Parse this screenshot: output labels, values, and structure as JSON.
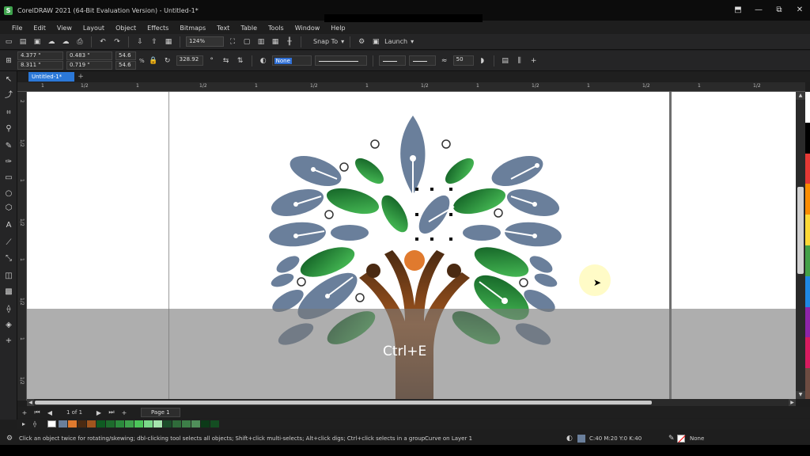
{
  "window": {
    "title": "CorelDRAW 2021 (64-Bit Evaluation Version) - Untitled-1*",
    "controls": [
      "⬒",
      "—",
      "⧉",
      "✕"
    ]
  },
  "menu": {
    "items": [
      "File",
      "Edit",
      "View",
      "Layout",
      "Object",
      "Effects",
      "Bitmaps",
      "Text",
      "Table",
      "Tools",
      "Window",
      "Help"
    ]
  },
  "toolbar": {
    "zoom": "124%",
    "snap_label": "Snap To",
    "launch_label": "Launch"
  },
  "properties": {
    "x": "4.377 \"",
    "y": "8.311 \"",
    "w": "0.483 \"",
    "h": "0.719 \"",
    "scale_w": "54.6",
    "scale_h": "54.6",
    "percent": "%",
    "rotation": "328.92",
    "fill": "None",
    "count": "50"
  },
  "doc_tab": {
    "label": "Untitled-1*"
  },
  "ruler": {
    "h_labels": [
      "1",
      "1/2",
      "1",
      "1/2",
      "1",
      "1/2",
      "1",
      "1/2",
      "1",
      "1/2",
      "1",
      "1/2",
      "1",
      "1/2",
      "1",
      "1/2",
      "1",
      "1/2"
    ],
    "v_labels": [
      "2",
      "1/2",
      "1",
      "1/2",
      "1",
      "1/2",
      "1",
      "1/2"
    ]
  },
  "canvas": {
    "shortcut_text": "Ctrl+E"
  },
  "colors": {
    "leaf_blue": "#6a7f9b",
    "leaf_green_dark": "#1d6b2c",
    "leaf_green_light": "#3fb04d",
    "trunk": "#8b4513",
    "orange": "#e07a2e",
    "accent": "#2b78d8"
  },
  "pagebar": {
    "count": "1 of 1",
    "page_label": "Page 1"
  },
  "status": {
    "hint": "Click an object twice for rotating/skewing; dbl-clicking tool selects all objects; Shift+click multi-selects; Alt+click digs; Ctrl+click selects in a group",
    "layer": "Curve on Layer 1",
    "cmyk": "C:40 M:20 Y:0 K:40",
    "outline": "None"
  }
}
